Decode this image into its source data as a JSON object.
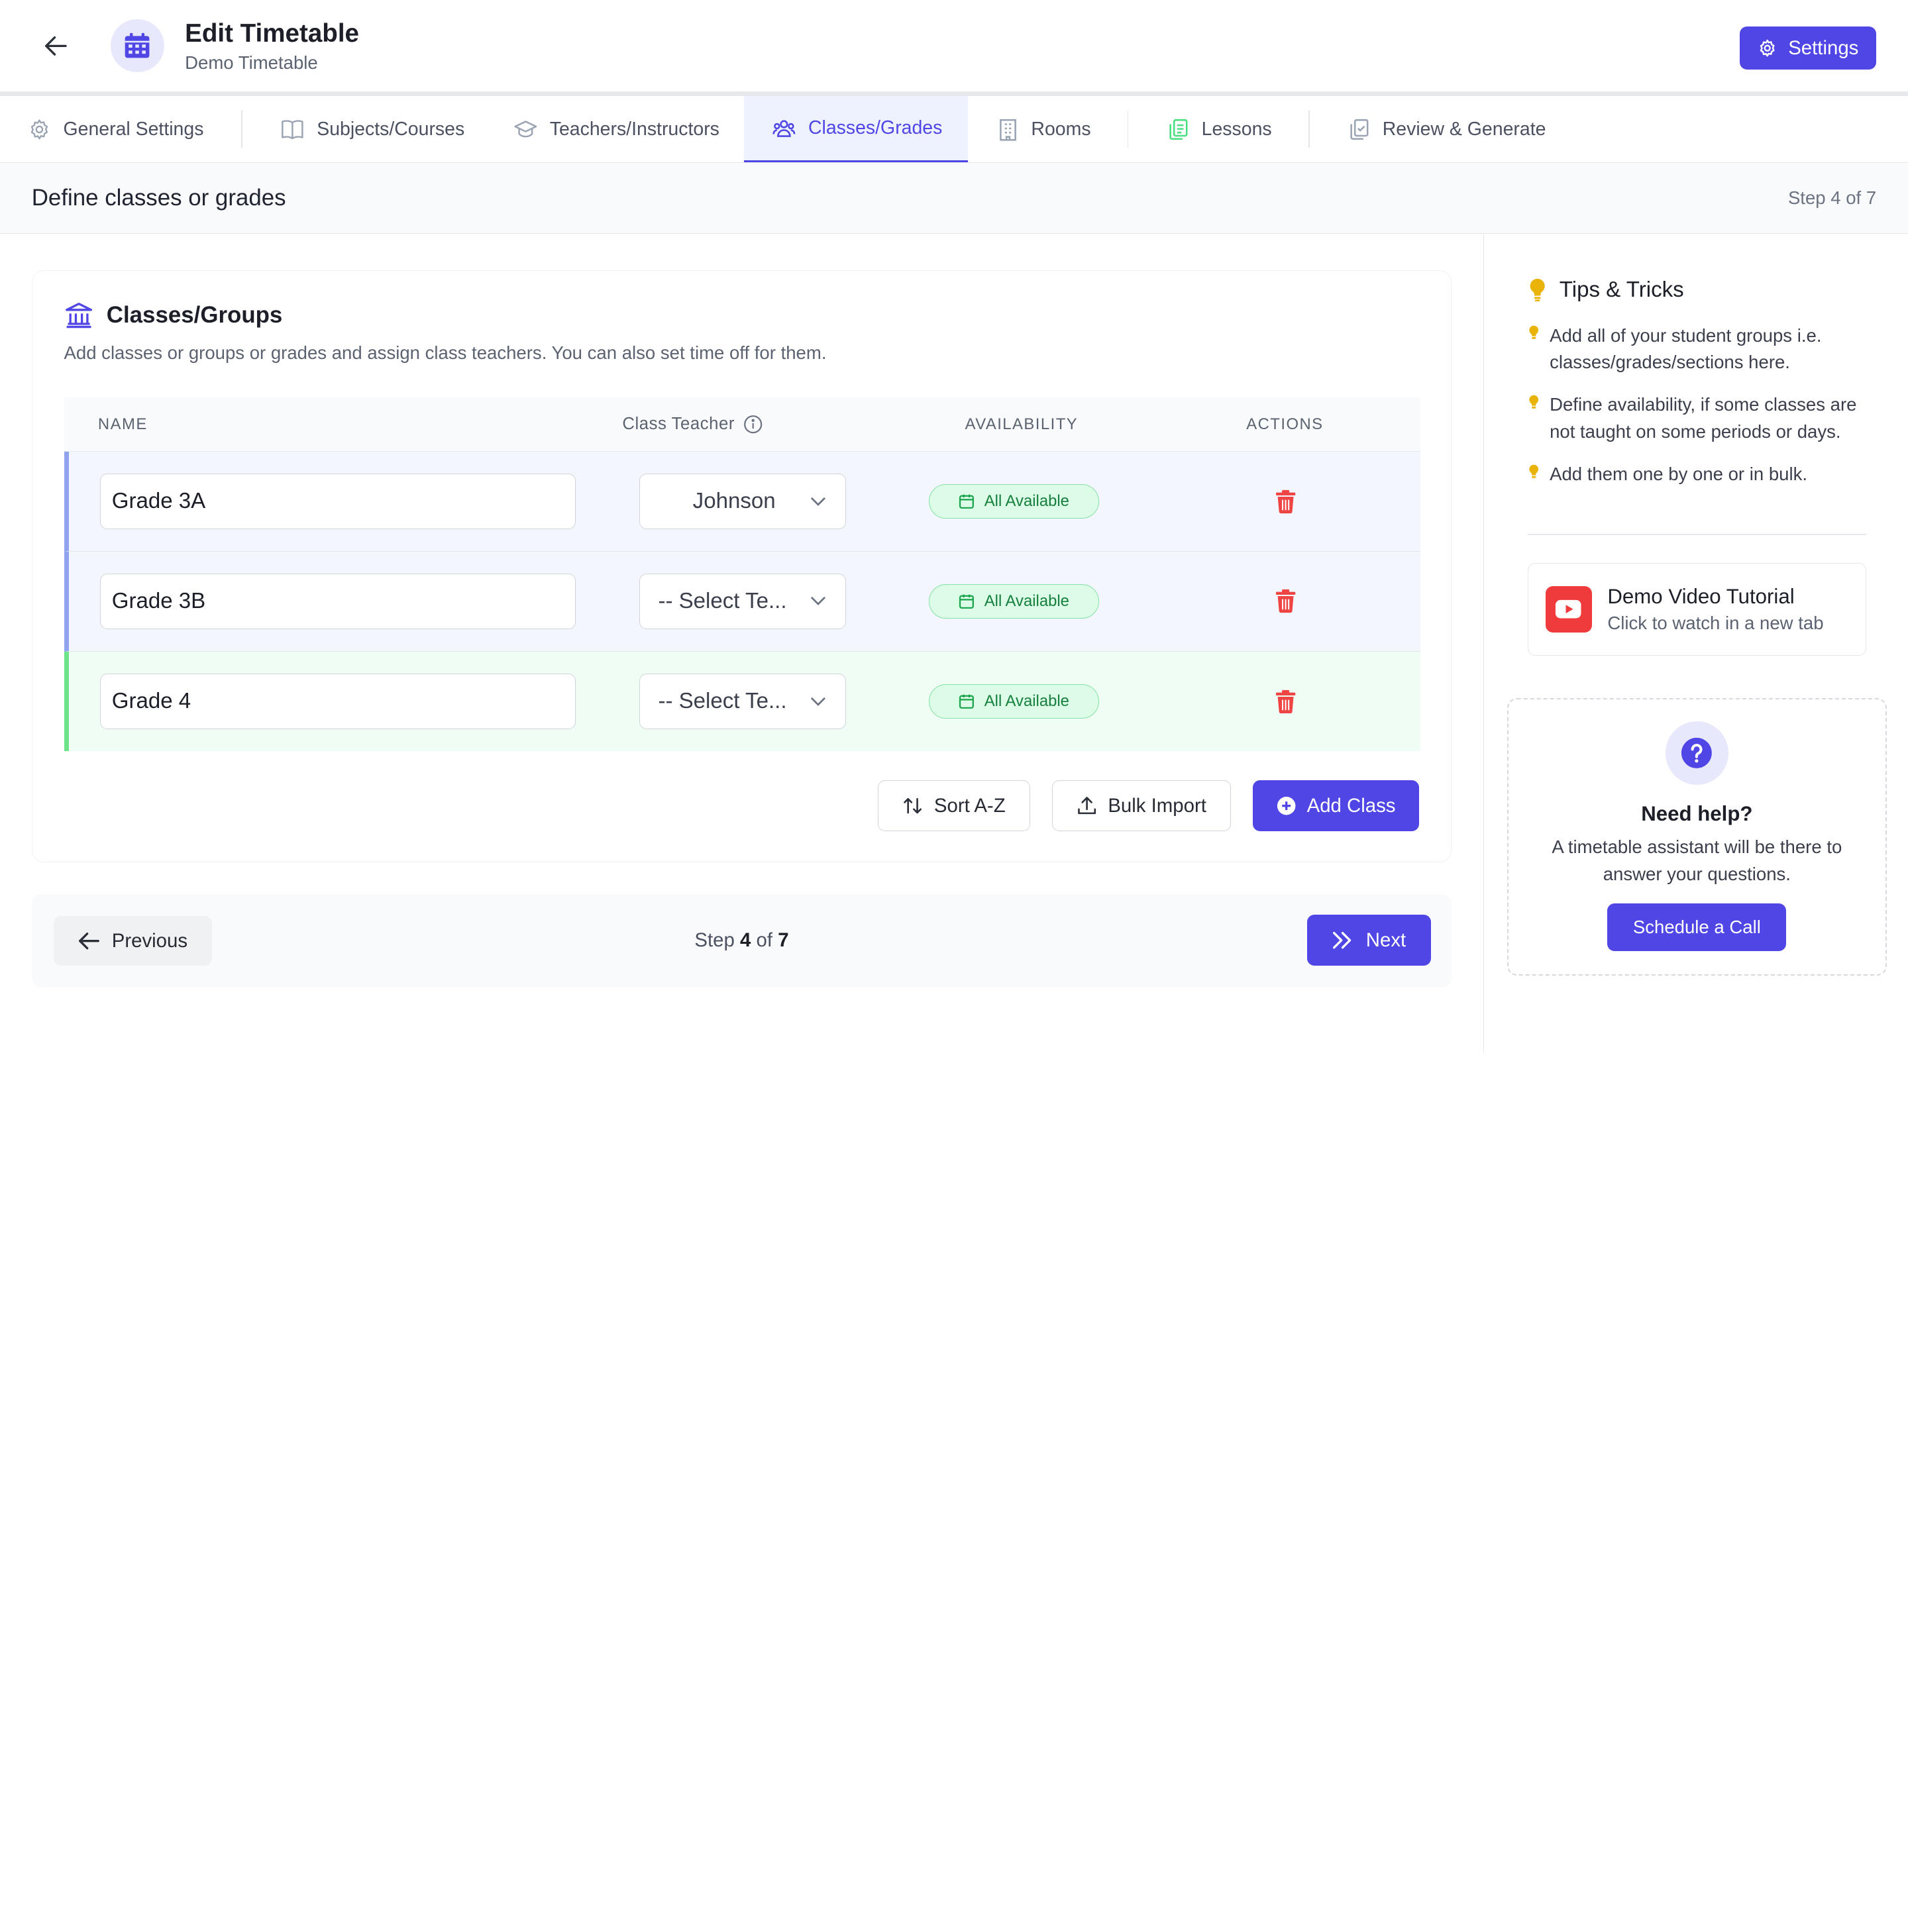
{
  "header": {
    "title": "Edit Timetable",
    "subtitle": "Demo Timetable",
    "settings_label": "Settings",
    "back_icon": "arrow-left-icon",
    "app_icon": "calendar-icon"
  },
  "tabs": [
    {
      "label": "General Settings",
      "icon": "gear-icon",
      "active": false
    },
    {
      "label": "Subjects/Courses",
      "icon": "book-icon",
      "active": false
    },
    {
      "label": "Teachers/Instructors",
      "icon": "graduation-cap-icon",
      "active": false
    },
    {
      "label": "Classes/Grades",
      "icon": "users-icon",
      "active": true
    },
    {
      "label": "Rooms",
      "icon": "building-icon",
      "active": false
    },
    {
      "label": "Lessons",
      "icon": "copy-icon",
      "active": false
    },
    {
      "label": "Review & Generate",
      "icon": "clipboard-check-icon",
      "active": false
    }
  ],
  "stepbar": {
    "title": "Define classes or grades",
    "step": "Step 4 of 7"
  },
  "card": {
    "title": "Classes/Groups",
    "description": "Add classes or groups or grades and assign class teachers. You can also set time off for them."
  },
  "table": {
    "headers": {
      "name": "NAME",
      "teacher": "Class Teacher",
      "availability": "AVAILABILITY",
      "actions": "ACTIONS"
    },
    "rows": [
      {
        "name": "Grade 3A",
        "teacher": "Johnson",
        "availability": "All Available"
      },
      {
        "name": "Grade 3B",
        "teacher": "-- Select Te...",
        "availability": "All Available"
      },
      {
        "name": "Grade 4",
        "teacher": "-- Select Te...",
        "availability": "All Available"
      }
    ]
  },
  "actions": {
    "sort": "Sort A-Z",
    "bulk_import": "Bulk Import",
    "add_class": "Add Class"
  },
  "footer": {
    "previous": "Previous",
    "step_word": "Step",
    "step_current": "4",
    "step_of": "of",
    "step_total": "7",
    "next": "Next"
  },
  "sidebar": {
    "tips_title": "Tips & Tricks",
    "tips": [
      "Add all of your student groups i.e. classes/grades/sections here.",
      "Define availability, if some classes are not taught on some periods or days.",
      "Add them one by one or in bulk."
    ],
    "video": {
      "title": "Demo Video Tutorial",
      "subtitle": "Click to watch in a new tab"
    },
    "help": {
      "title": "Need help?",
      "text": "A timetable assistant will be there to answer your questions.",
      "button": "Schedule a Call"
    }
  },
  "colors": {
    "accent": "#4f46e5",
    "danger": "#ef4444",
    "success": "#15803d",
    "tip": "#eab308"
  }
}
